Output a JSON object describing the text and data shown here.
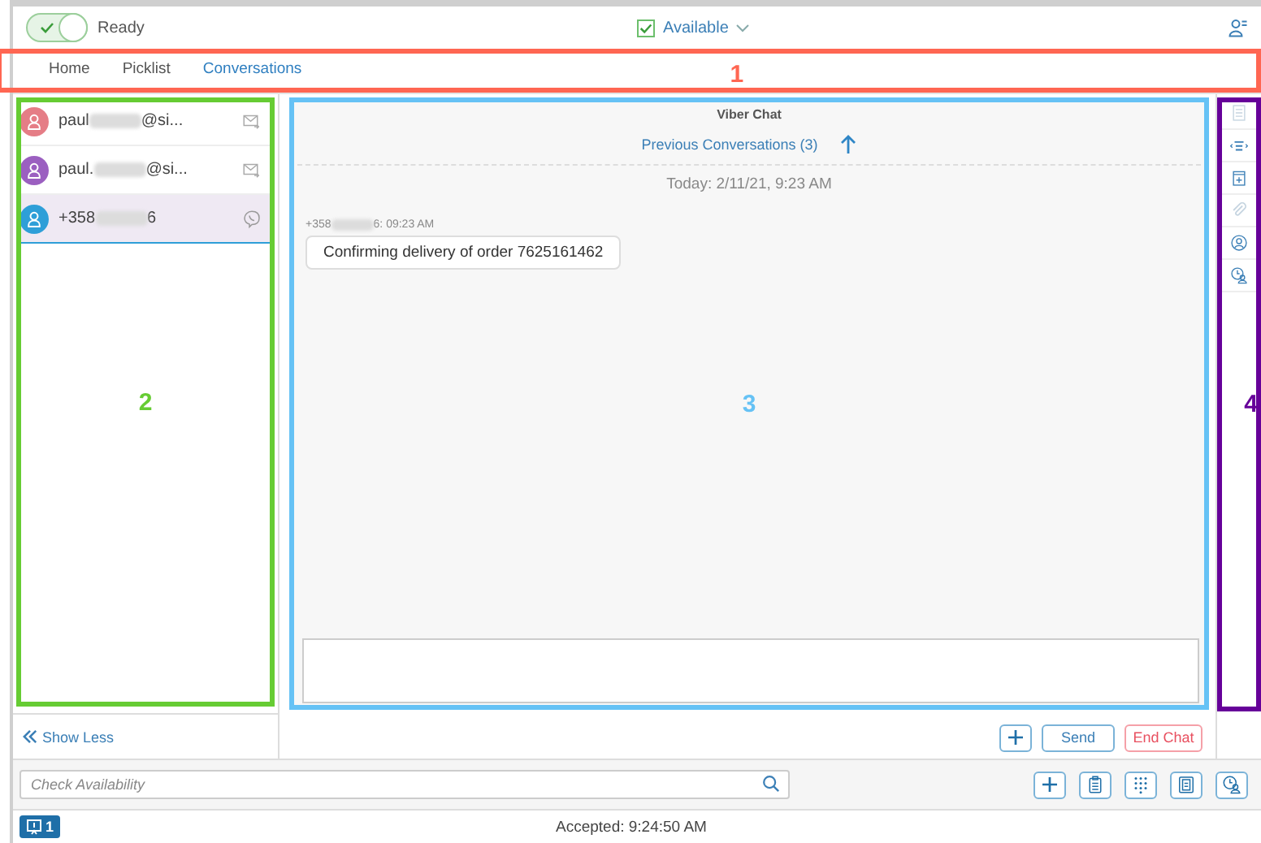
{
  "topbar": {
    "ready_toggle": {
      "on": true
    },
    "ready_label": "Ready",
    "availability": {
      "checked": true,
      "label": "Available"
    }
  },
  "tabs": [
    {
      "label": "Home",
      "selected": false
    },
    {
      "label": "Picklist",
      "selected": false
    },
    {
      "label": "Conversations",
      "selected": true
    }
  ],
  "conversations": [
    {
      "prefix": "paul",
      "suffix": "@si...",
      "color": "#e57d86",
      "kind": "email",
      "selected": false
    },
    {
      "prefix": "paul.",
      "suffix": "@si...",
      "color": "#9b5fc0",
      "kind": "email",
      "selected": false
    },
    {
      "prefix": "+358",
      "suffix": "6",
      "color": "#2e9fd8",
      "kind": "viber",
      "selected": true
    }
  ],
  "show_less": "Show Less",
  "chat": {
    "title": "Viber Chat",
    "previous": "Previous Conversations (3)",
    "date": "Today: 2/11/21, 9:23 AM",
    "messages": [
      {
        "sender_prefix": "+358",
        "sender_suffix": "6: 09:23 AM",
        "text": "Confirming delivery of order 7625161462"
      }
    ],
    "buttons": [
      {
        "kind": "add"
      },
      {
        "kind": "send",
        "label": "Send"
      },
      {
        "kind": "end",
        "label": "End Chat"
      }
    ]
  },
  "side_toolbar": [
    {
      "kind": "notes",
      "disabled": true
    },
    {
      "kind": "transcript",
      "disabled": false
    },
    {
      "kind": "calendar",
      "disabled": false
    },
    {
      "kind": "attachment",
      "disabled": true
    },
    {
      "kind": "contact",
      "disabled": false
    },
    {
      "kind": "contact-search",
      "disabled": false
    }
  ],
  "search": {
    "placeholder": "Check Availability"
  },
  "bottom_buttons": [
    {
      "kind": "add"
    },
    {
      "kind": "clipboard"
    },
    {
      "kind": "dialpad"
    },
    {
      "kind": "addressbook"
    },
    {
      "kind": "contact-search"
    }
  ],
  "status_bar": {
    "badge": "1",
    "text": "Accepted: 9:24:50 AM"
  },
  "annotations": [
    {
      "label": "1",
      "color": "#ff6652",
      "kind": "tabs"
    },
    {
      "label": "2",
      "color": "#66cc33",
      "kind": "list"
    },
    {
      "label": "3",
      "color": "#66c2f5",
      "kind": "chat"
    },
    {
      "label": "4",
      "color": "#660099",
      "kind": "toolbar"
    }
  ]
}
